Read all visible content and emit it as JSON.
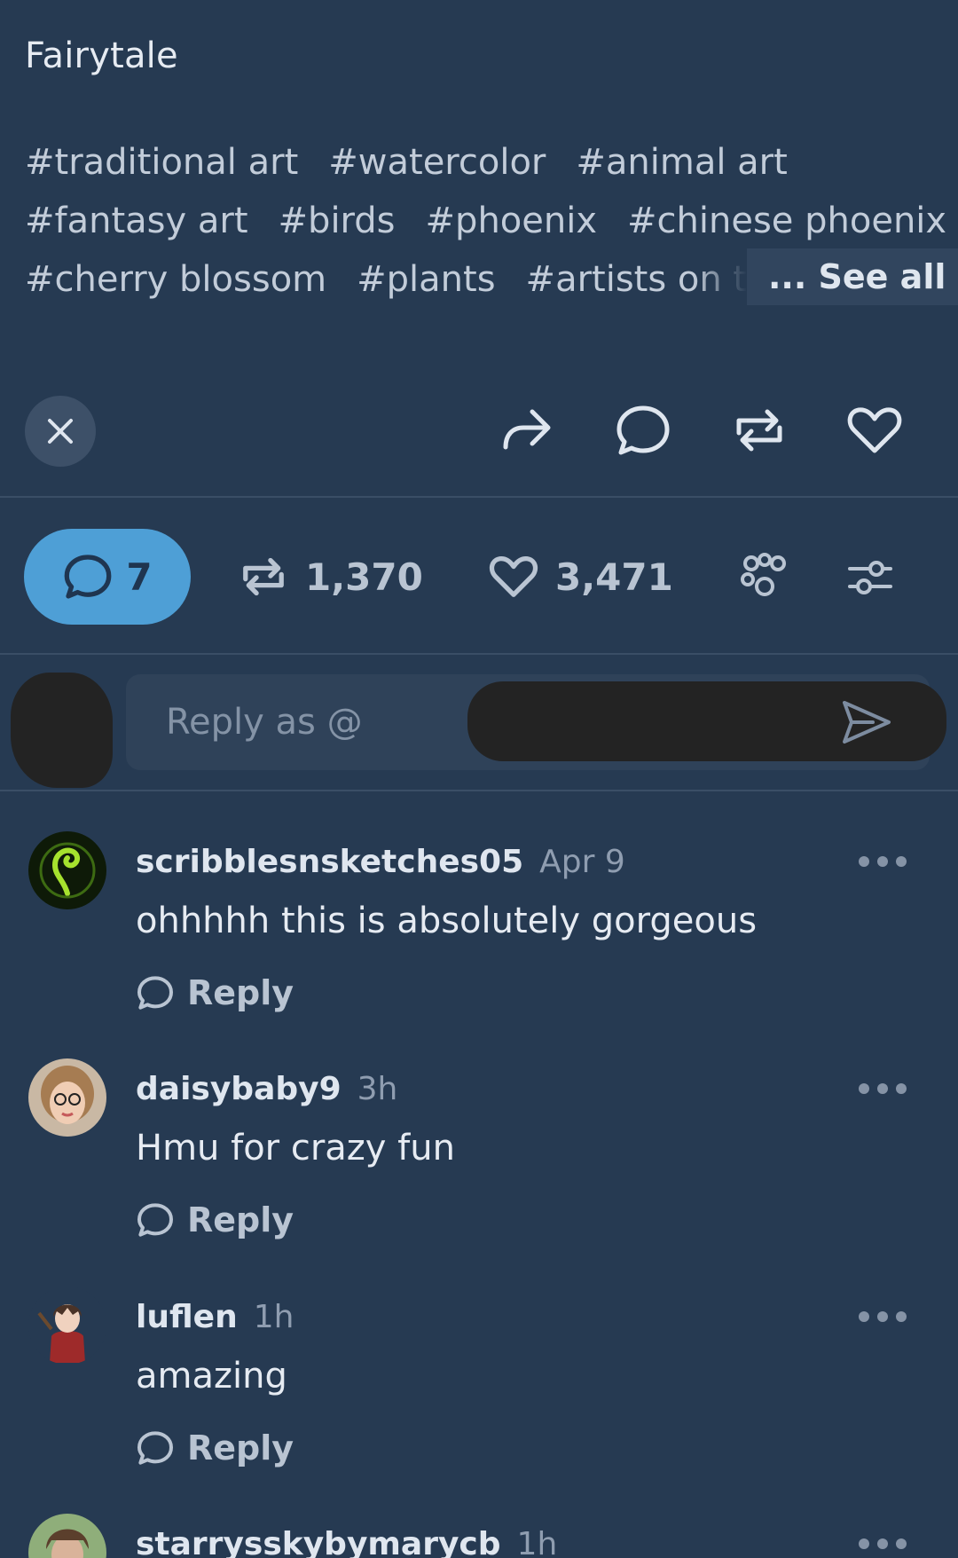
{
  "post": {
    "title": "Fairytale",
    "tags_line1": [
      "#traditional art",
      "#watercolor",
      "#animal art"
    ],
    "tags_line2": [
      "#fantasy art",
      "#birds",
      "#phoenix",
      "#chinese phoenix"
    ],
    "tags_line3": [
      "#cherry blossom",
      "#plants",
      "#artists on tur"
    ],
    "see_all": "... See all"
  },
  "stats": {
    "comments": "7",
    "reblogs": "1,370",
    "likes": "3,471"
  },
  "reply_box": {
    "placeholder": "Reply as @"
  },
  "comments": [
    {
      "user": "scribblesnsketches05",
      "time": "Apr 9",
      "text": "ohhhhh this is absolutely gorgeous",
      "reply": "Reply"
    },
    {
      "user": "daisybaby9",
      "time": "3h",
      "text": "Hmu for crazy fun",
      "reply": "Reply"
    },
    {
      "user": "luflen",
      "time": "1h",
      "text": "amazing",
      "reply": "Reply"
    },
    {
      "user": "starrysskybymarycb",
      "time": "1h",
      "text": "",
      "reply": ""
    }
  ],
  "colors": {
    "background": "#263a52",
    "accent": "#4e9fd6"
  }
}
